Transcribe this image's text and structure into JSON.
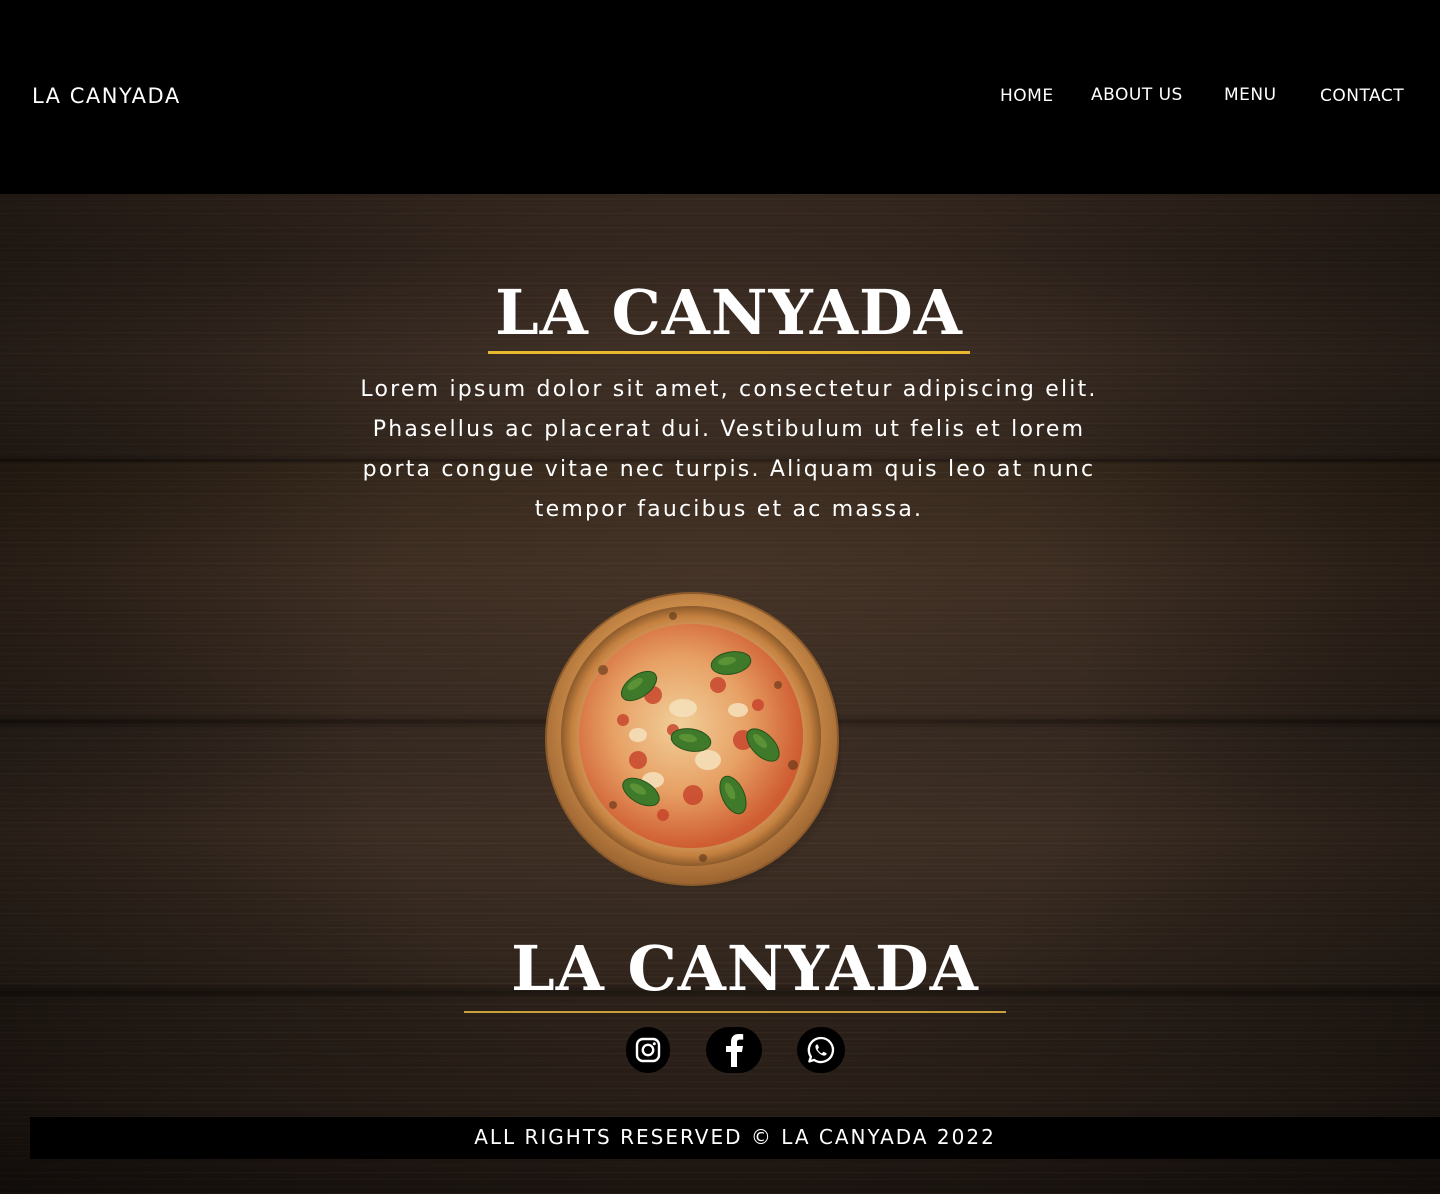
{
  "header": {
    "brand": "LA CANYADA",
    "nav": [
      {
        "label": "HOME"
      },
      {
        "label": "ABOUT US"
      },
      {
        "label": "MENU"
      },
      {
        "label": "CONTACT"
      }
    ]
  },
  "hero": {
    "title": "LA CANYADA",
    "text": "Lorem ipsum dolor sit amet, consectetur adipiscing elit. Phasellus ac placerat dui. Vestibulum ut felis et lorem porta congue vitae nec turpis. Aliquam quis leo at nunc tempor faucibus et ac massa."
  },
  "footer": {
    "title": "LA CANYADA",
    "social": [
      {
        "icon": "instagram-icon"
      },
      {
        "icon": "facebook-icon"
      },
      {
        "icon": "whatsapp-icon"
      }
    ],
    "copyright": "ALL RIGHTS RESERVED © LA CANYADA 2022"
  },
  "colors": {
    "accent": "#e8b92f",
    "header_bg": "#000000",
    "wood": "#3a2b22"
  }
}
